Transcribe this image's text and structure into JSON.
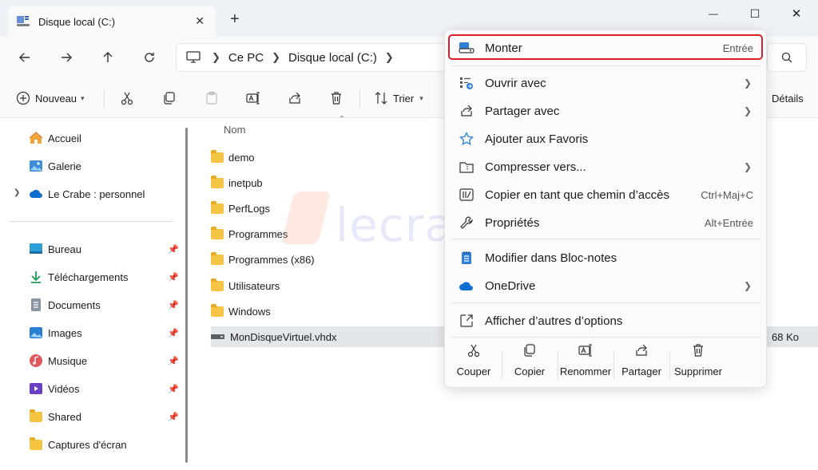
{
  "window": {
    "tab_title": "Disque local (C:)",
    "tab_close": "✕",
    "new_tab": "+"
  },
  "window_controls": {
    "minimize": "—",
    "maximize": "☐",
    "close": "✕"
  },
  "address": {
    "crumbs": [
      "Ce PC",
      "Disque local (C:)"
    ]
  },
  "toolbar": {
    "new_label": "Nouveau",
    "sort_label": "Trier",
    "details_label": "Détails"
  },
  "sidebar": {
    "top_items": [
      "Accueil",
      "Galerie",
      "Le Crabe : personnel"
    ],
    "pinned_items": [
      "Bureau",
      "Téléchargements",
      "Documents",
      "Images",
      "Musique",
      "Vidéos",
      "Shared",
      "Captures d'écran"
    ]
  },
  "content": {
    "column_name": "Nom",
    "files": [
      "demo",
      "inetpub",
      "PerfLogs",
      "Programmes",
      "Programmes (x86)",
      "Utilisateurs",
      "Windows",
      "MonDisqueVirtuel.vhdx"
    ],
    "selected_size": "68 Ko"
  },
  "watermark": "lecrabeinfo",
  "context_menu": {
    "items": [
      {
        "label": "Monter",
        "shortcut": "Entrée"
      },
      {
        "label": "Ouvrir avec",
        "shortcut": ""
      },
      {
        "label": "Partager avec",
        "shortcut": ""
      },
      {
        "label": "Ajouter aux Favoris",
        "shortcut": ""
      },
      {
        "label": "Compresser vers...",
        "shortcut": ""
      },
      {
        "label": "Copier en tant que chemin d’accès",
        "shortcut": "Ctrl+Maj+C"
      },
      {
        "label": "Propriétés",
        "shortcut": "Alt+Entrée"
      },
      {
        "label": "Modifier dans Bloc-notes",
        "shortcut": ""
      },
      {
        "label": "OneDrive",
        "shortcut": ""
      },
      {
        "label": "Afficher d’autres d’options",
        "shortcut": ""
      }
    ],
    "actions": [
      "Couper",
      "Copier",
      "Renommer",
      "Partager",
      "Supprimer"
    ]
  },
  "colors": {
    "highlight_border": "#d92028",
    "folder": "#f6c443",
    "accent": "#0067c0"
  }
}
